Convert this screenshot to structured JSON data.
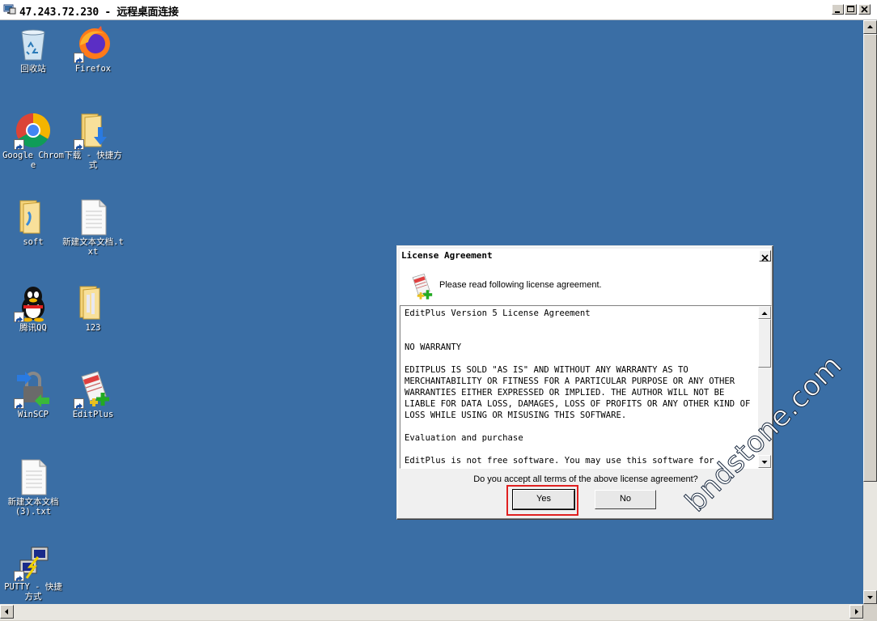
{
  "window": {
    "title": "47.243.72.230 - 远程桌面连接"
  },
  "desktop": {
    "icons": [
      {
        "label": "回收站",
        "icon": "recycle-bin-icon"
      },
      {
        "label": "Firefox",
        "icon": "firefox-icon"
      },
      {
        "label": "Google Chrome",
        "icon": "chrome-icon"
      },
      {
        "label": "下载 - 快捷方式",
        "icon": "downloads-folder-icon"
      },
      {
        "label": "soft",
        "icon": "folder-icon"
      },
      {
        "label": "新建文本文档.txt",
        "icon": "text-file-icon"
      },
      {
        "label": "腾讯QQ",
        "icon": "qq-icon"
      },
      {
        "label": "123",
        "icon": "folder-icon"
      },
      {
        "label": "WinSCP",
        "icon": "winscp-icon"
      },
      {
        "label": "EditPlus",
        "icon": "editplus-icon"
      },
      {
        "label": "新建文本文档 (3).txt",
        "icon": "text-file-icon"
      },
      {
        "label": "PUTTY - 快捷方式",
        "icon": "putty-icon"
      }
    ]
  },
  "dialog": {
    "title": "License Agreement",
    "header_text": "Please read following license agreement.",
    "license_text": "EditPlus Version 5 License Agreement\n\n\nNO WARRANTY\n\nEDITPLUS IS SOLD \"AS IS\" AND WITHOUT ANY WARRANTY AS TO MERCHANTABILITY OR FITNESS FOR A PARTICULAR PURPOSE OR ANY OTHER WARRANTIES EITHER EXPRESSED OR IMPLIED. THE AUTHOR WILL NOT BE LIABLE FOR DATA LOSS, DAMAGES, LOSS OF PROFITS OR ANY OTHER KIND OF LOSS WHILE USING OR MISUSING THIS SOFTWARE.\n\nEvaluation and purchase\n\nEditPlus is not free software. You may use this software for",
    "question": "Do you accept all terms of the above license agreement?",
    "yes_label": "Yes",
    "no_label": "No"
  },
  "watermark": "bndstone.com",
  "colors": {
    "desktop": "#3a6ea5",
    "highlight": "#e02020"
  }
}
